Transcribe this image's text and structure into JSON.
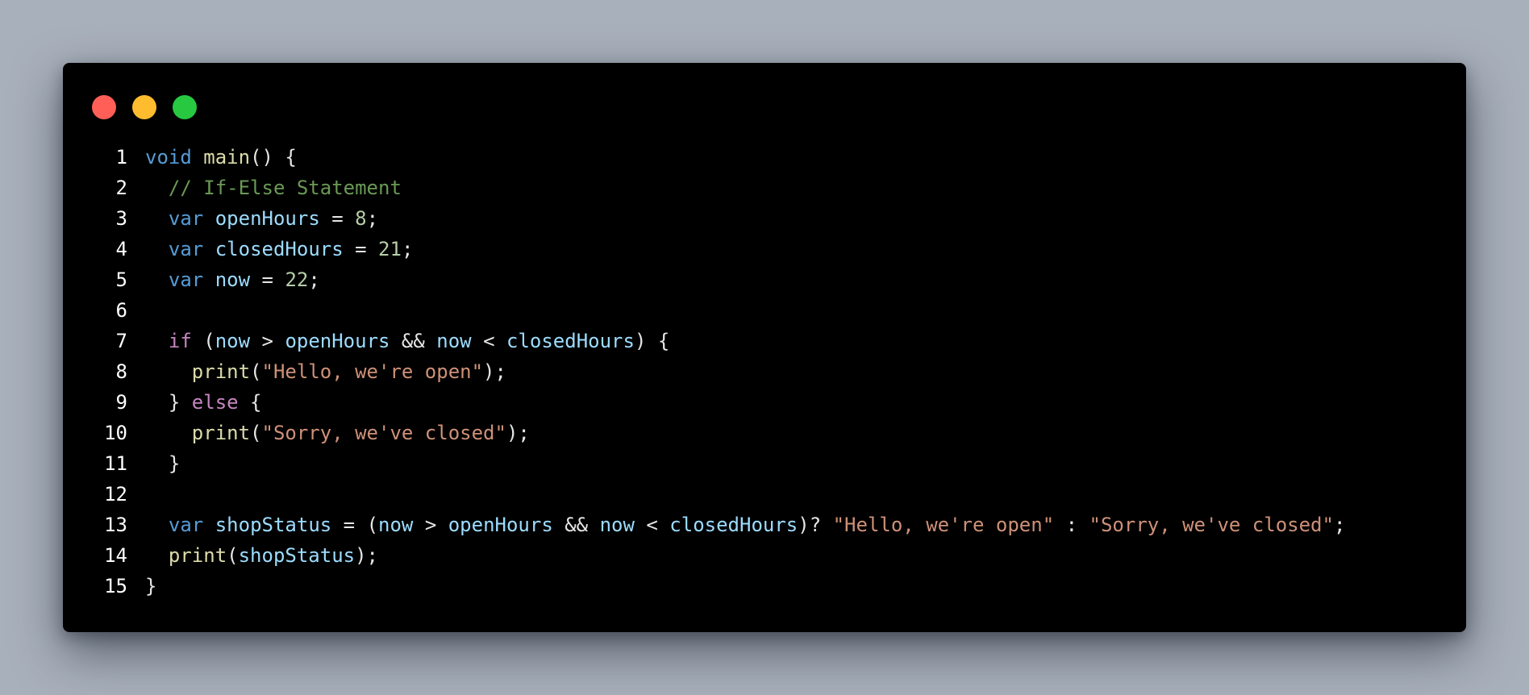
{
  "window": {
    "traffic_lights": [
      {
        "name": "close",
        "color": "#ff5f57"
      },
      {
        "name": "minimize",
        "color": "#febc2e"
      },
      {
        "name": "maximize",
        "color": "#28c840"
      }
    ]
  },
  "code": {
    "lines": [
      {
        "n": "1",
        "tokens": [
          {
            "t": "kw",
            "v": "void"
          },
          {
            "t": "pn",
            "v": " "
          },
          {
            "t": "fn",
            "v": "main"
          },
          {
            "t": "pn",
            "v": "() {"
          }
        ]
      },
      {
        "n": "2",
        "tokens": [
          {
            "t": "pn",
            "v": "  "
          },
          {
            "t": "cm",
            "v": "// If-Else Statement"
          }
        ]
      },
      {
        "n": "3",
        "tokens": [
          {
            "t": "pn",
            "v": "  "
          },
          {
            "t": "kw",
            "v": "var"
          },
          {
            "t": "pn",
            "v": " "
          },
          {
            "t": "var",
            "v": "openHours"
          },
          {
            "t": "pn",
            "v": " = "
          },
          {
            "t": "num",
            "v": "8"
          },
          {
            "t": "pn",
            "v": ";"
          }
        ]
      },
      {
        "n": "4",
        "tokens": [
          {
            "t": "pn",
            "v": "  "
          },
          {
            "t": "kw",
            "v": "var"
          },
          {
            "t": "pn",
            "v": " "
          },
          {
            "t": "var",
            "v": "closedHours"
          },
          {
            "t": "pn",
            "v": " = "
          },
          {
            "t": "num",
            "v": "21"
          },
          {
            "t": "pn",
            "v": ";"
          }
        ]
      },
      {
        "n": "5",
        "tokens": [
          {
            "t": "pn",
            "v": "  "
          },
          {
            "t": "kw",
            "v": "var"
          },
          {
            "t": "pn",
            "v": " "
          },
          {
            "t": "var",
            "v": "now"
          },
          {
            "t": "pn",
            "v": " = "
          },
          {
            "t": "num",
            "v": "22"
          },
          {
            "t": "pn",
            "v": ";"
          }
        ]
      },
      {
        "n": "6",
        "tokens": []
      },
      {
        "n": "7",
        "tokens": [
          {
            "t": "pn",
            "v": "  "
          },
          {
            "t": "ctrl",
            "v": "if"
          },
          {
            "t": "pn",
            "v": " ("
          },
          {
            "t": "var",
            "v": "now"
          },
          {
            "t": "pn",
            "v": " > "
          },
          {
            "t": "var",
            "v": "openHours"
          },
          {
            "t": "pn",
            "v": " && "
          },
          {
            "t": "var",
            "v": "now"
          },
          {
            "t": "pn",
            "v": " < "
          },
          {
            "t": "var",
            "v": "closedHours"
          },
          {
            "t": "pn",
            "v": ") {"
          }
        ]
      },
      {
        "n": "8",
        "tokens": [
          {
            "t": "pn",
            "v": "    "
          },
          {
            "t": "fn",
            "v": "print"
          },
          {
            "t": "pn",
            "v": "("
          },
          {
            "t": "str",
            "v": "\"Hello, we're open\""
          },
          {
            "t": "pn",
            "v": ");"
          }
        ]
      },
      {
        "n": "9",
        "tokens": [
          {
            "t": "pn",
            "v": "  } "
          },
          {
            "t": "ctrl",
            "v": "else"
          },
          {
            "t": "pn",
            "v": " {"
          }
        ]
      },
      {
        "n": "10",
        "tokens": [
          {
            "t": "pn",
            "v": "    "
          },
          {
            "t": "fn",
            "v": "print"
          },
          {
            "t": "pn",
            "v": "("
          },
          {
            "t": "str",
            "v": "\"Sorry, we've closed\""
          },
          {
            "t": "pn",
            "v": ");"
          }
        ]
      },
      {
        "n": "11",
        "tokens": [
          {
            "t": "pn",
            "v": "  }"
          }
        ]
      },
      {
        "n": "12",
        "tokens": []
      },
      {
        "n": "13",
        "tokens": [
          {
            "t": "pn",
            "v": "  "
          },
          {
            "t": "kw",
            "v": "var"
          },
          {
            "t": "pn",
            "v": " "
          },
          {
            "t": "var",
            "v": "shopStatus"
          },
          {
            "t": "pn",
            "v": " = ("
          },
          {
            "t": "var",
            "v": "now"
          },
          {
            "t": "pn",
            "v": " > "
          },
          {
            "t": "var",
            "v": "openHours"
          },
          {
            "t": "pn",
            "v": " && "
          },
          {
            "t": "var",
            "v": "now"
          },
          {
            "t": "pn",
            "v": " < "
          },
          {
            "t": "var",
            "v": "closedHours"
          },
          {
            "t": "pn",
            "v": ")? "
          },
          {
            "t": "str",
            "v": "\"Hello, we're open\""
          },
          {
            "t": "pn",
            "v": " : "
          },
          {
            "t": "str",
            "v": "\"Sorry, we've closed\""
          },
          {
            "t": "pn",
            "v": ";"
          }
        ]
      },
      {
        "n": "14",
        "tokens": [
          {
            "t": "pn",
            "v": "  "
          },
          {
            "t": "fn",
            "v": "print"
          },
          {
            "t": "pn",
            "v": "("
          },
          {
            "t": "var",
            "v": "shopStatus"
          },
          {
            "t": "pn",
            "v": ");"
          }
        ]
      },
      {
        "n": "15",
        "tokens": [
          {
            "t": "pn",
            "v": "}"
          }
        ]
      }
    ]
  }
}
